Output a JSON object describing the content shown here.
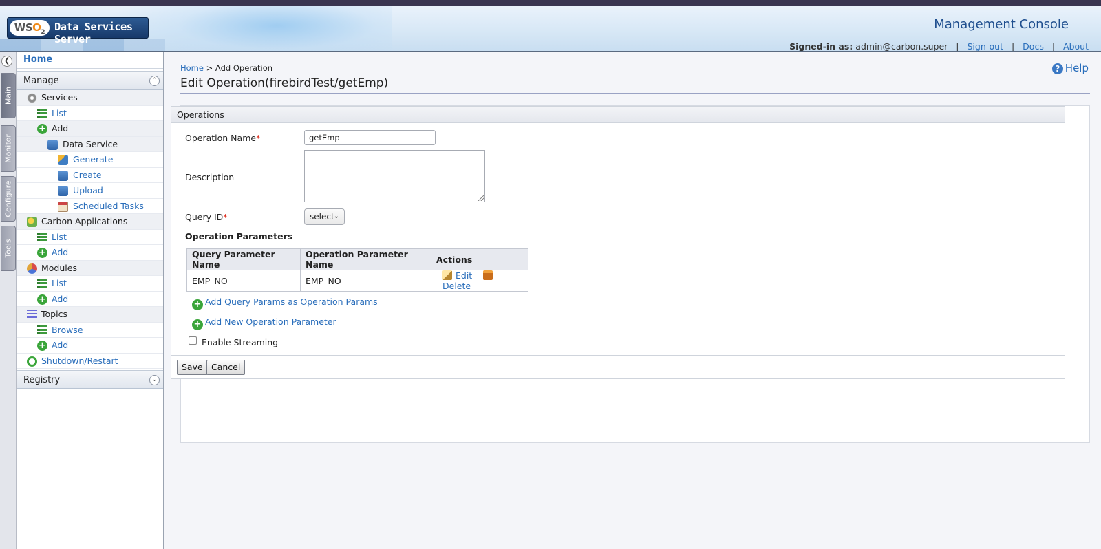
{
  "header": {
    "logo_badge_a": "WS",
    "logo_badge_o": "O",
    "logo_badge_sub": "2",
    "logo_text": "Data Services Server",
    "console_title": "Management Console",
    "signed_in_label": "Signed-in as:",
    "signed_in_user": "admin@carbon.super",
    "sign_out": "Sign-out",
    "docs": "Docs",
    "about": "About"
  },
  "tabs": [
    "Main",
    "Monitor",
    "Configure",
    "Tools"
  ],
  "sidebar": {
    "home": "Home",
    "manage": "Manage",
    "services": "Services",
    "services_list": "List",
    "services_add": "Add",
    "data_service": "Data Service",
    "generate": "Generate",
    "create": "Create",
    "upload": "Upload",
    "scheduled_tasks": "Scheduled Tasks",
    "carbon_apps": "Carbon Applications",
    "capp_list": "List",
    "capp_add": "Add",
    "modules": "Modules",
    "modules_list": "List",
    "modules_add": "Add",
    "topics": "Topics",
    "topics_browse": "Browse",
    "topics_add": "Add",
    "shutdown": "Shutdown/Restart",
    "registry": "Registry"
  },
  "main": {
    "breadcrumb_home": "Home",
    "breadcrumb_sep": ">",
    "breadcrumb_current": "Add Operation",
    "help": "Help",
    "title": "Edit Operation(firebirdTest/getEmp)",
    "box_title": "Operations",
    "op_name_label": "Operation Name",
    "op_name_value": "getEmp",
    "description_label": "Description",
    "query_id_label": "Query ID",
    "query_id_selected": "select",
    "params_title": "Operation Parameters",
    "table": {
      "headers": [
        "Query Parameter Name",
        "Operation Parameter Name",
        "Actions"
      ],
      "rows": [
        {
          "query_param": "EMP_NO",
          "op_param": "EMP_NO",
          "edit": "Edit",
          "delete": "Delete"
        }
      ]
    },
    "add_query_params": "Add Query Params as Operation Params",
    "add_new_param": "Add New Operation Parameter",
    "enable_streaming": "Enable Streaming",
    "save": "Save",
    "cancel": "Cancel"
  },
  "colors": {
    "link": "#2a6ebb",
    "required": "#dd2211",
    "header_title": "#1f4f8f",
    "add_green": "#3aa53a"
  }
}
